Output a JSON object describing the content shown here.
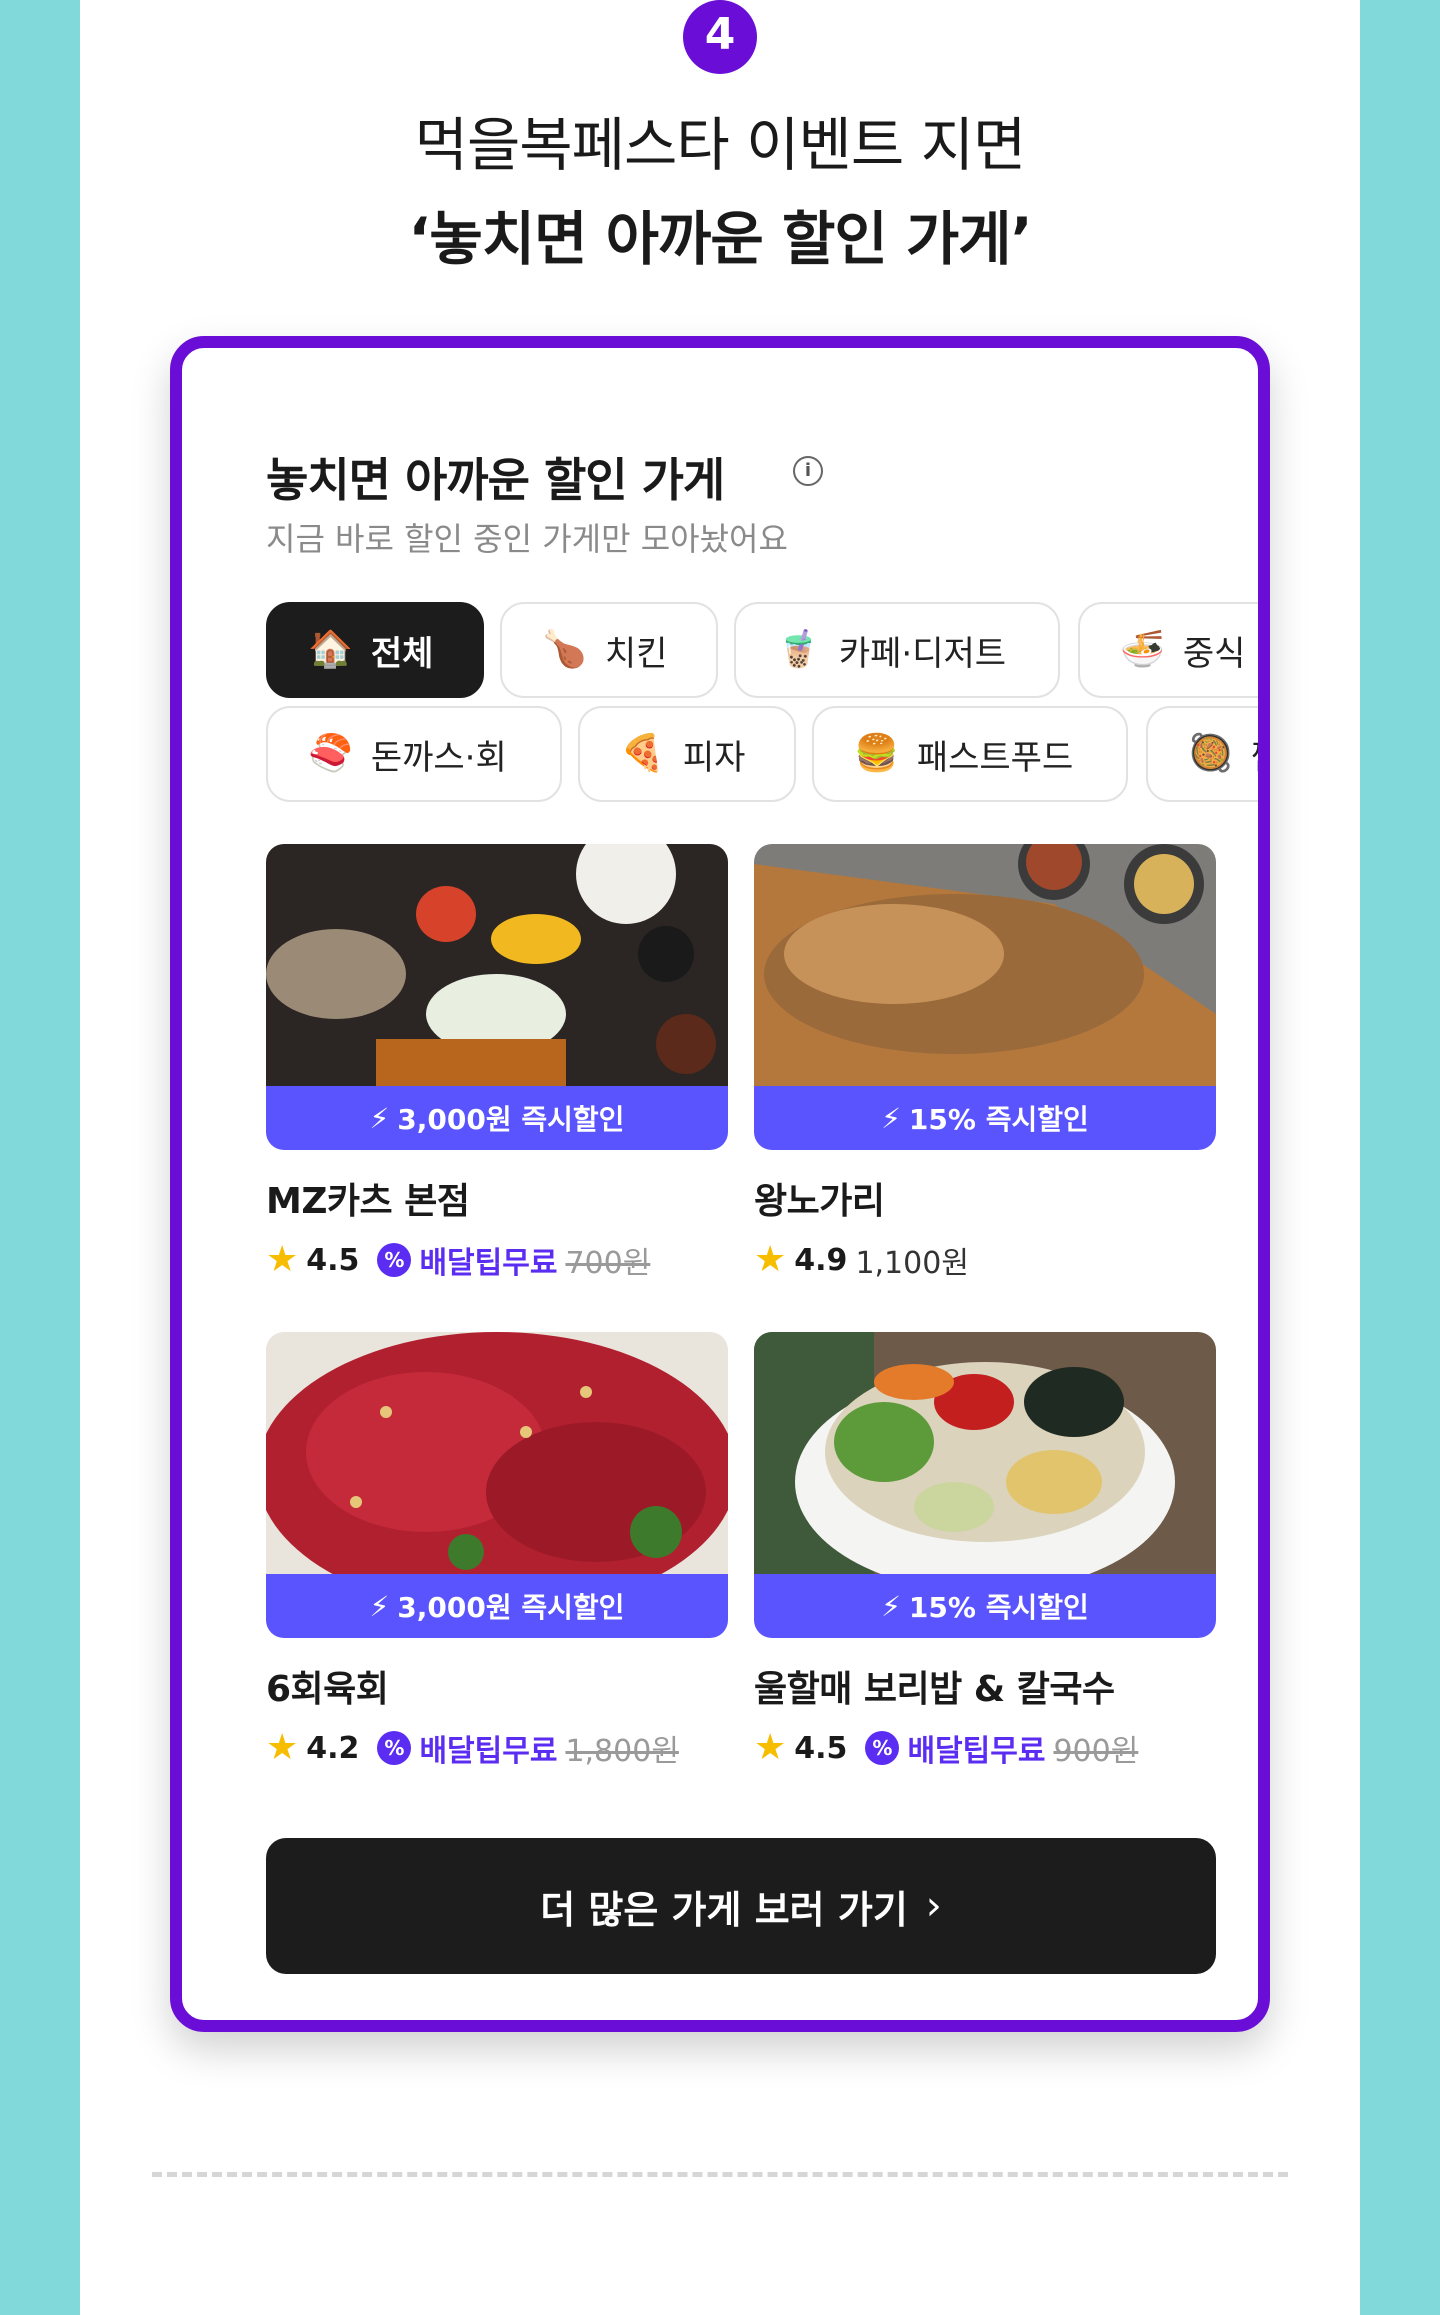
{
  "step_number": "4",
  "headline": {
    "line1": "먹을복페스타 이벤트 지면",
    "line2": "‘놓치면 아까운 할인 가게’"
  },
  "section": {
    "title": "놓치면 아까운 할인 가게",
    "info_icon": "info-icon",
    "subtitle": "지금 바로 할인 중인 가게만 모아놨어요"
  },
  "categories_row1": [
    {
      "label": "전체",
      "emoji": "🏠"
    },
    {
      "label": "치킨",
      "emoji": "🍗"
    },
    {
      "label": "카페·디저트",
      "emoji": "🧋"
    },
    {
      "label": "중식",
      "emoji": "🍜"
    }
  ],
  "categories_row2": [
    {
      "label": "돈까스·회",
      "emoji": "🍣"
    },
    {
      "label": "피자",
      "emoji": "🍕"
    },
    {
      "label": "패스트푸드",
      "emoji": "🍔"
    },
    {
      "label": "찜",
      "emoji": "🥘"
    }
  ],
  "stores": [
    {
      "name": "MZ카츠 본점",
      "deal": "3,000원 즉시할인",
      "rating": "4.5",
      "free_delivery": "배달팁무료",
      "old_fee": "700원",
      "fee": ""
    },
    {
      "name": "왕노가리",
      "deal": "15% 즉시할인",
      "rating": "4.9",
      "free_delivery": "",
      "old_fee": "",
      "fee": "1,100원"
    },
    {
      "name": "6회육회",
      "deal": "3,000원 즉시할인",
      "rating": "4.2",
      "free_delivery": "배달팁무료",
      "old_fee": "1,800원",
      "fee": ""
    },
    {
      "name": "울할매 보리밥 & 칼국수",
      "deal": "15% 즉시할인",
      "rating": "4.5",
      "free_delivery": "배달팁무료",
      "old_fee": "900원",
      "fee": ""
    }
  ],
  "more_button": {
    "label": "더 많은 가게 보러 가기",
    "chevron": "›"
  },
  "colors": {
    "accent": "#6a0dd6",
    "deal_bar": "#5a54ff",
    "free_delivery": "#5b2cf2",
    "background": "#82d9d9"
  }
}
